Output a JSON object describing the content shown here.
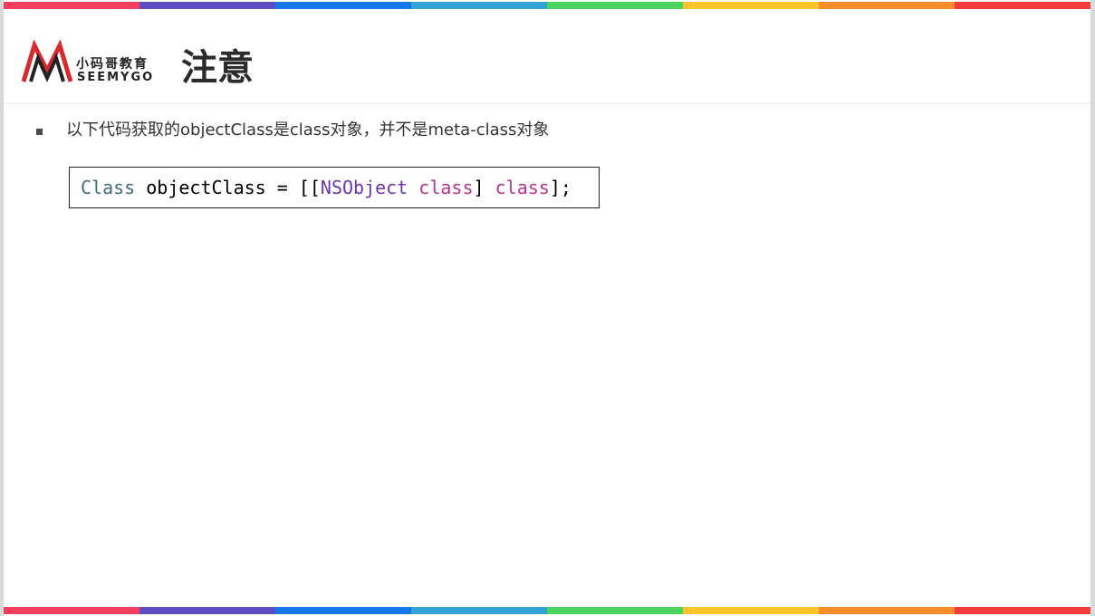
{
  "colors": {
    "stripe": [
      "#f43f5e",
      "#5b4ec0",
      "#1877e8",
      "#34a3d8",
      "#4cd463",
      "#fcc62b",
      "#fb8c2a",
      "#f43a3a"
    ]
  },
  "logo": {
    "cn": "小码哥教育",
    "en": "SEEMYGO"
  },
  "page": {
    "title": "注意"
  },
  "bullets": [
    {
      "text": "以下代码获取的objectClass是class对象，并不是meta-class对象"
    }
  ],
  "code": {
    "tokens": [
      {
        "text": "Class",
        "kind": "type"
      },
      {
        "text": " objectClass = [[",
        "kind": "plain"
      },
      {
        "text": "NSObject",
        "kind": "cls"
      },
      {
        "text": " ",
        "kind": "plain"
      },
      {
        "text": "class",
        "kind": "kw"
      },
      {
        "text": "] ",
        "kind": "plain"
      },
      {
        "text": "class",
        "kind": "kw"
      },
      {
        "text": "];",
        "kind": "plain"
      }
    ]
  }
}
